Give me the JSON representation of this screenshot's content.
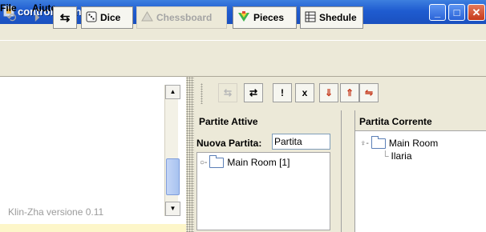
{
  "window": {
    "title": "controlli Klin-Zha",
    "minimize": "_",
    "maximize": "□",
    "close": "✕"
  },
  "menu": [
    "File",
    "Aiuto"
  ],
  "toolbar": {
    "nav_icons": [
      "⟲",
      "⏵"
    ],
    "swap_icon": "⇆",
    "buttons": [
      {
        "label": "Dice",
        "icon": "dice-icon",
        "enabled": true
      },
      {
        "label": "Chessboard",
        "icon": "warning-triangle-icon",
        "enabled": false
      },
      {
        "label": "Pieces",
        "icon": "pieces-icon",
        "enabled": true
      },
      {
        "label": "Shedule",
        "icon": "table-icon",
        "enabled": true
      }
    ]
  },
  "left_panel": {
    "version_text": "Klin-Zha versione 0.11"
  },
  "inner_toolbar": {
    "buttons": [
      "⇆",
      "⇄",
      "!",
      "x",
      "⇓",
      "⇑",
      "⇋"
    ]
  },
  "partite_attive": {
    "title": "Partite Attive",
    "new_label": "Nuova Partita:",
    "new_value": "Partita",
    "rooms": [
      "Main Room [1]"
    ]
  },
  "partita_corrente": {
    "title": "Partita Corrente",
    "room": "Main Room",
    "players": [
      "Ilaria"
    ]
  },
  "colors": {
    "titlebar": "#1f5cd0",
    "frame": "#ece9d8",
    "background": "#fdf6c9"
  }
}
